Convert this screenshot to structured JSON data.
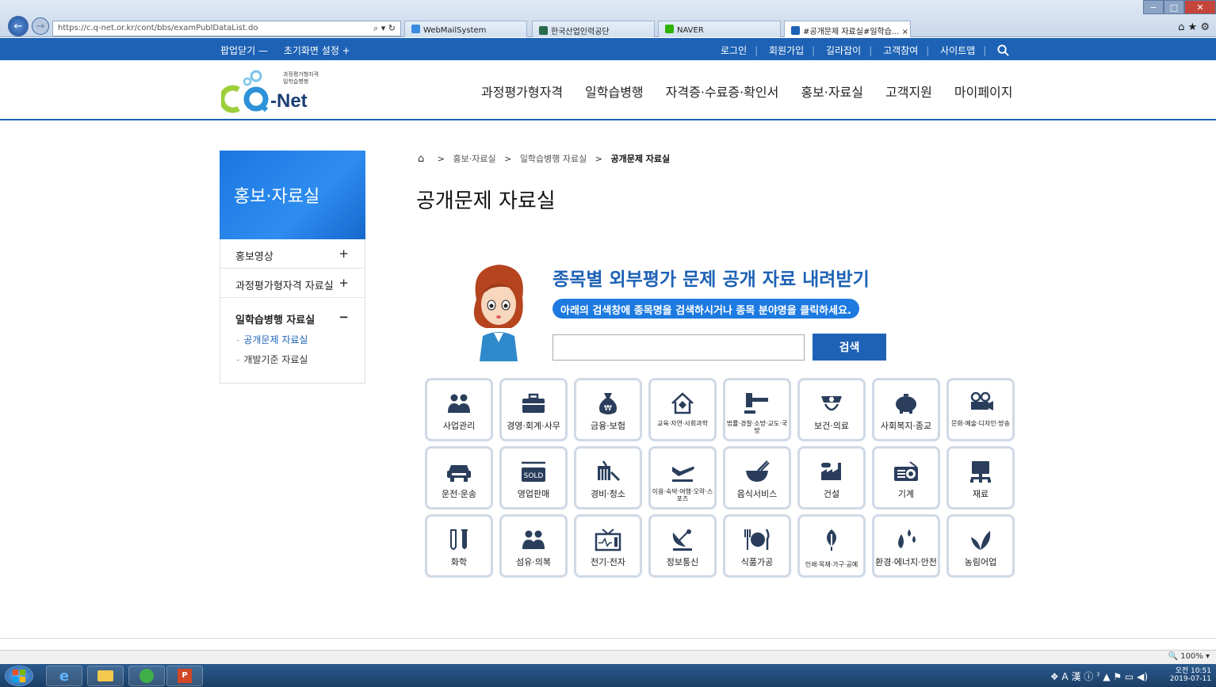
{
  "browser": {
    "url": "https://c.q-net.or.kr/cont/bbs/examPublDataList.do",
    "address_icons": "⌕ ▾ ↻",
    "tabs": [
      {
        "label": "WebMailSystem",
        "color": "#3b8be0"
      },
      {
        "label": "한국산업인력공단",
        "color": "#2b6b4a"
      },
      {
        "label": "NAVER",
        "color": "#2db400"
      },
      {
        "label": "#공개문제 자료실#일학습... ×",
        "color": "#1d62b5"
      }
    ],
    "right_icons": "⌂ ★ ⚙"
  },
  "util": {
    "left": [
      "팝업닫기 —",
      "초기화면 설정 +"
    ],
    "right": [
      "로그인",
      "회원가입",
      "길라잡이",
      "고객참여",
      "사이트맵"
    ],
    "search_icon": "search-icon"
  },
  "header": {
    "logo_small": [
      "과정평가형자격",
      "일학습병행"
    ],
    "logo_text": "-Net",
    "gnb": [
      "과정평가형자격",
      "일학습병행",
      "자격증·수료증·확인서",
      "홍보·자료실",
      "고객지원",
      "마이페이지"
    ]
  },
  "sidebar": {
    "title": "홍보·자료실",
    "items": [
      {
        "label": "홍보영상",
        "sign": "+"
      },
      {
        "label": "과정평가형자격 자료실",
        "sign": "+"
      },
      {
        "label": "일학습병행 자료실",
        "sign": "−"
      }
    ],
    "sub_items": [
      "공개문제 자료실",
      "개발기준 자료실"
    ]
  },
  "breadcrumb": {
    "items": [
      "홍보·자료실",
      "일학습병행 자료실"
    ],
    "current": "공개문제 자료실"
  },
  "page": {
    "title": "공개문제 자료실",
    "search_heading": "종목별 외부평가 문제 공개 자료 내려받기",
    "search_sub": "아래의 검색창에 종목명을 검색하시거나 종목 분야명을 클릭하세요.",
    "search_button": "검색",
    "search_value": ""
  },
  "categories": [
    {
      "label": "사업관리",
      "icon": "people-icon"
    },
    {
      "label": "경영·회계·사무",
      "icon": "briefcase-icon"
    },
    {
      "label": "금융·보험",
      "icon": "money-bag-icon"
    },
    {
      "label": "교육·자연·사회과학",
      "icon": "house-icon",
      "small": true
    },
    {
      "label": "법률·경찰·소방·교도·국방",
      "icon": "gavel-icon",
      "small": true
    },
    {
      "label": "보건·의료",
      "icon": "nurse-cap-icon"
    },
    {
      "label": "사회복지·종교",
      "icon": "piggy-bank-icon"
    },
    {
      "label": "문화·예술·디자인·방송",
      "icon": "film-camera-icon",
      "small": true
    },
    {
      "label": "운전·운송",
      "icon": "car-icon"
    },
    {
      "label": "영업판매",
      "icon": "sold-sign-icon"
    },
    {
      "label": "경비·청소",
      "icon": "broom-icon"
    },
    {
      "label": "이용·숙박·여행·오락·스포츠",
      "icon": "airplane-icon",
      "small": true
    },
    {
      "label": "음식서비스",
      "icon": "bowl-icon"
    },
    {
      "label": "건설",
      "icon": "factory-icon"
    },
    {
      "label": "기계",
      "icon": "radio-icon"
    },
    {
      "label": "재료",
      "icon": "monitor-icon"
    },
    {
      "label": "화학",
      "icon": "test-tubes-icon"
    },
    {
      "label": "섬유·의복",
      "icon": "people-icon"
    },
    {
      "label": "전기·전자",
      "icon": "tv-icon"
    },
    {
      "label": "정보통신",
      "icon": "satellite-dish-icon"
    },
    {
      "label": "식품가공",
      "icon": "plate-icon"
    },
    {
      "label": "인쇄·목재·가구·공예",
      "icon": "leaf-icon",
      "tiny": true
    },
    {
      "label": "환경·에너지·안전",
      "icon": "drops-icon"
    },
    {
      "label": "농림어업",
      "icon": "sprout-icon"
    }
  ],
  "status": {
    "zoom": "🔍 100% ▾"
  },
  "taskbar": {
    "time": "오전 10:51",
    "date": "2019-07-11",
    "tray": "❖ A 漢 ⓘ ˀ ▲ ⚑ ▭ ◀)"
  },
  "colors": {
    "brand": "#1d62b5",
    "accent": "#1d7ae0"
  }
}
